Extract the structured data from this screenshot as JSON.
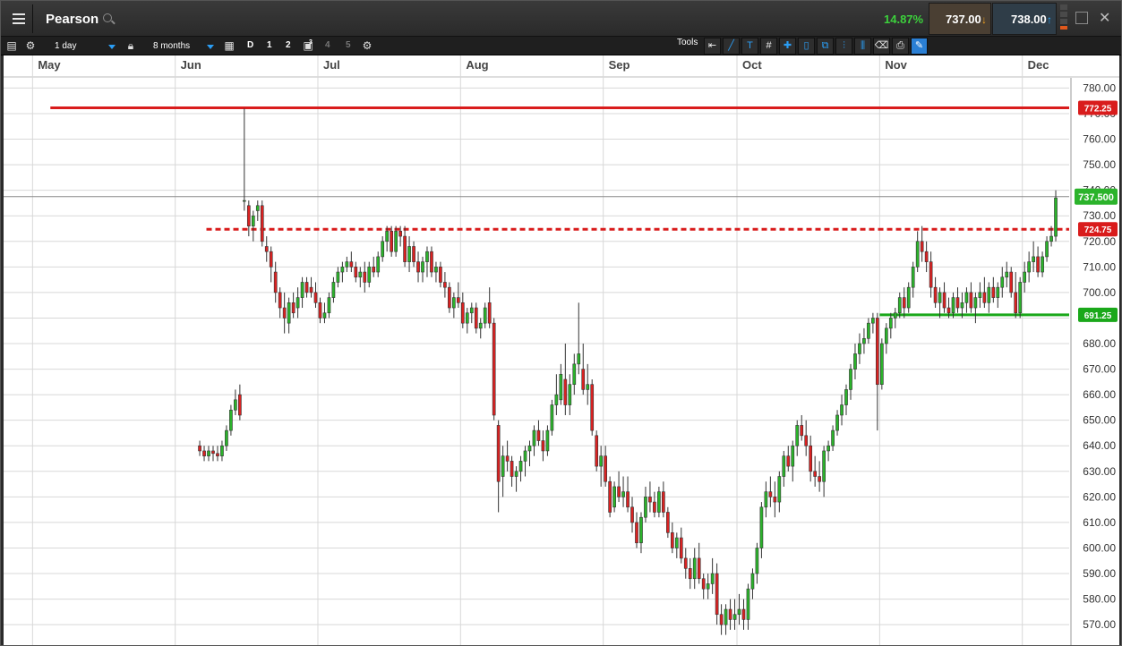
{
  "header": {
    "title": "Pearson",
    "change_pct": "14.87%",
    "sell_price": "737.00",
    "buy_price": "738.00"
  },
  "toolbar": {
    "interval": "1 day",
    "range": "8 months",
    "periods": [
      "D",
      "1",
      "2",
      "3",
      "4",
      "5"
    ],
    "tools_label": "Tools"
  },
  "colors": {
    "up": "#2bb32b",
    "down": "#d92222",
    "resistance": "#d91c1c",
    "support": "#1aa81a",
    "grid": "#d8d8d8",
    "accent": "#2a9df4"
  },
  "chart_data": {
    "type": "candlestick",
    "ylim": [
      562,
      784
    ],
    "yticks": [
      570,
      580,
      590,
      600,
      610,
      620,
      630,
      640,
      650,
      660,
      670,
      680,
      690,
      700,
      710,
      720,
      730,
      740,
      750,
      760,
      770,
      780
    ],
    "ytick_labels": [
      "570.00",
      "580.00",
      "590.00",
      "600.00",
      "610.00",
      "620.00",
      "630.00",
      "640.00",
      "650.00",
      "660.00",
      "670.00",
      "680.00",
      "690.00",
      "700.00",
      "710.00",
      "720.00",
      "730.00",
      "740.00",
      "750.00",
      "760.00",
      "770.00",
      "780.00"
    ],
    "months": [
      "May",
      "Jun",
      "Jul",
      "Aug",
      "Sep",
      "Oct",
      "Nov",
      "Dec"
    ],
    "month_start_index": [
      8,
      40,
      72,
      104,
      136,
      166,
      198,
      230
    ],
    "n_days": 238,
    "levels": [
      {
        "label": "772.25",
        "value": 772.25,
        "style": "solid",
        "color": "resistance",
        "from_index": 12
      },
      {
        "label": "724.75",
        "value": 724.75,
        "style": "dashed",
        "color": "resistance",
        "from_index": 47
      },
      {
        "label": "691.25",
        "value": 691.25,
        "style": "solid",
        "color": "support",
        "from_index": 198
      }
    ],
    "last_price": {
      "label": "737.500",
      "value": 737.5
    },
    "ohlc": [
      [
        640,
        642,
        636,
        638
      ],
      [
        638,
        640,
        634,
        636
      ],
      [
        636,
        640,
        634,
        638
      ],
      [
        638,
        640,
        634,
        637
      ],
      [
        637,
        640,
        634,
        636
      ],
      [
        636,
        642,
        634,
        640
      ],
      [
        640,
        648,
        638,
        646
      ],
      [
        646,
        656,
        644,
        654
      ],
      [
        654,
        662,
        652,
        658
      ],
      [
        660,
        664,
        650,
        652
      ],
      [
        736,
        772,
        732,
        736
      ],
      [
        734,
        736,
        722,
        726
      ],
      [
        726,
        732,
        720,
        730
      ],
      [
        732,
        736,
        728,
        734
      ],
      [
        734,
        736,
        718,
        720
      ],
      [
        718,
        722,
        712,
        716
      ],
      [
        716,
        718,
        704,
        710
      ],
      [
        708,
        712,
        696,
        700
      ],
      [
        700,
        702,
        690,
        694
      ],
      [
        694,
        700,
        684,
        690
      ],
      [
        688,
        698,
        684,
        696
      ],
      [
        696,
        700,
        690,
        692
      ],
      [
        694,
        702,
        690,
        698
      ],
      [
        698,
        706,
        694,
        704
      ],
      [
        704,
        706,
        698,
        700
      ],
      [
        702,
        706,
        698,
        700
      ],
      [
        700,
        704,
        694,
        696
      ],
      [
        696,
        698,
        688,
        690
      ],
      [
        690,
        696,
        688,
        692
      ],
      [
        692,
        700,
        690,
        698
      ],
      [
        698,
        706,
        696,
        704
      ],
      [
        704,
        710,
        702,
        708
      ],
      [
        708,
        712,
        704,
        710
      ],
      [
        710,
        714,
        708,
        712
      ],
      [
        712,
        716,
        708,
        710
      ],
      [
        710,
        712,
        704,
        706
      ],
      [
        706,
        710,
        702,
        708
      ],
      [
        708,
        712,
        700,
        704
      ],
      [
        704,
        712,
        702,
        710
      ],
      [
        710,
        714,
        706,
        708
      ],
      [
        708,
        716,
        706,
        714
      ],
      [
        714,
        722,
        712,
        720
      ],
      [
        720,
        726,
        716,
        724
      ],
      [
        724,
        726,
        714,
        716
      ],
      [
        716,
        726,
        714,
        724
      ],
      [
        724,
        726,
        718,
        722
      ],
      [
        722,
        726,
        710,
        712
      ],
      [
        712,
        722,
        708,
        718
      ],
      [
        718,
        720,
        710,
        712
      ],
      [
        712,
        716,
        704,
        708
      ],
      [
        708,
        714,
        704,
        712
      ],
      [
        712,
        718,
        706,
        716
      ],
      [
        716,
        718,
        706,
        708
      ],
      [
        708,
        712,
        704,
        710
      ],
      [
        710,
        712,
        702,
        704
      ],
      [
        704,
        708,
        698,
        702
      ],
      [
        702,
        704,
        692,
        694
      ],
      [
        694,
        700,
        690,
        698
      ],
      [
        698,
        704,
        694,
        696
      ],
      [
        696,
        700,
        686,
        688
      ],
      [
        688,
        694,
        684,
        692
      ],
      [
        692,
        696,
        688,
        694
      ],
      [
        694,
        696,
        684,
        686
      ],
      [
        686,
        690,
        682,
        688
      ],
      [
        688,
        696,
        686,
        694
      ],
      [
        696,
        702,
        686,
        688
      ],
      [
        688,
        690,
        650,
        652
      ],
      [
        648,
        650,
        614,
        626
      ],
      [
        628,
        640,
        620,
        636
      ],
      [
        636,
        642,
        630,
        634
      ],
      [
        634,
        636,
        624,
        628
      ],
      [
        628,
        632,
        622,
        630
      ],
      [
        630,
        636,
        626,
        634
      ],
      [
        634,
        640,
        628,
        638
      ],
      [
        638,
        642,
        632,
        640
      ],
      [
        640,
        648,
        636,
        646
      ],
      [
        646,
        650,
        640,
        642
      ],
      [
        642,
        646,
        634,
        638
      ],
      [
        638,
        648,
        636,
        646
      ],
      [
        646,
        658,
        644,
        656
      ],
      [
        656,
        668,
        652,
        660
      ],
      [
        658,
        672,
        656,
        668
      ],
      [
        666,
        680,
        652,
        656
      ],
      [
        656,
        668,
        652,
        664
      ],
      [
        664,
        676,
        660,
        672
      ],
      [
        672,
        696,
        668,
        676
      ],
      [
        670,
        680,
        660,
        662
      ],
      [
        662,
        672,
        656,
        664
      ],
      [
        664,
        666,
        644,
        646
      ],
      [
        644,
        646,
        630,
        632
      ],
      [
        632,
        640,
        624,
        636
      ],
      [
        636,
        640,
        624,
        626
      ],
      [
        626,
        628,
        612,
        614
      ],
      [
        616,
        626,
        614,
        624
      ],
      [
        624,
        630,
        618,
        620
      ],
      [
        620,
        628,
        616,
        622
      ],
      [
        622,
        628,
        614,
        616
      ],
      [
        616,
        620,
        606,
        610
      ],
      [
        610,
        614,
        600,
        602
      ],
      [
        602,
        614,
        598,
        612
      ],
      [
        612,
        624,
        610,
        620
      ],
      [
        620,
        626,
        614,
        618
      ],
      [
        618,
        622,
        612,
        614
      ],
      [
        614,
        624,
        612,
        622
      ],
      [
        622,
        626,
        612,
        614
      ],
      [
        614,
        616,
        604,
        606
      ],
      [
        606,
        610,
        598,
        600
      ],
      [
        600,
        606,
        596,
        604
      ],
      [
        604,
        608,
        594,
        596
      ],
      [
        596,
        600,
        588,
        592
      ],
      [
        592,
        596,
        584,
        588
      ],
      [
        588,
        600,
        584,
        596
      ],
      [
        596,
        602,
        586,
        588
      ],
      [
        588,
        590,
        580,
        584
      ],
      [
        584,
        590,
        580,
        586
      ],
      [
        586,
        596,
        582,
        590
      ],
      [
        590,
        594,
        570,
        574
      ],
      [
        574,
        578,
        566,
        570
      ],
      [
        570,
        578,
        566,
        576
      ],
      [
        576,
        580,
        568,
        572
      ],
      [
        572,
        580,
        568,
        574
      ],
      [
        574,
        582,
        570,
        576
      ],
      [
        576,
        580,
        568,
        572
      ],
      [
        572,
        586,
        568,
        584
      ],
      [
        584,
        592,
        580,
        590
      ],
      [
        590,
        602,
        586,
        600
      ],
      [
        600,
        618,
        596,
        616
      ],
      [
        616,
        626,
        612,
        622
      ],
      [
        622,
        628,
        616,
        620
      ],
      [
        620,
        626,
        612,
        618
      ],
      [
        618,
        630,
        614,
        628
      ],
      [
        628,
        638,
        624,
        636
      ],
      [
        636,
        640,
        630,
        632
      ],
      [
        632,
        642,
        626,
        640
      ],
      [
        640,
        650,
        636,
        648
      ],
      [
        648,
        652,
        642,
        644
      ],
      [
        644,
        650,
        636,
        640
      ],
      [
        640,
        644,
        626,
        630
      ],
      [
        630,
        636,
        624,
        628
      ],
      [
        628,
        634,
        622,
        626
      ],
      [
        626,
        640,
        620,
        638
      ],
      [
        638,
        642,
        634,
        640
      ],
      [
        640,
        648,
        638,
        646
      ],
      [
        646,
        654,
        644,
        652
      ],
      [
        652,
        660,
        648,
        656
      ],
      [
        656,
        664,
        652,
        662
      ],
      [
        662,
        672,
        658,
        670
      ],
      [
        670,
        680,
        666,
        676
      ],
      [
        676,
        684,
        672,
        680
      ],
      [
        680,
        686,
        676,
        682
      ],
      [
        682,
        690,
        680,
        688
      ],
      [
        688,
        692,
        684,
        690
      ],
      [
        690,
        692,
        646,
        664
      ],
      [
        664,
        682,
        662,
        680
      ],
      [
        680,
        688,
        676,
        686
      ],
      [
        686,
        692,
        682,
        690
      ],
      [
        690,
        694,
        686,
        692
      ],
      [
        692,
        700,
        690,
        698
      ],
      [
        698,
        702,
        690,
        694
      ],
      [
        694,
        704,
        692,
        702
      ],
      [
        702,
        712,
        698,
        710
      ],
      [
        710,
        724,
        708,
        720
      ],
      [
        720,
        726,
        712,
        716
      ],
      [
        716,
        720,
        708,
        712
      ],
      [
        712,
        716,
        698,
        702
      ],
      [
        702,
        706,
        694,
        696
      ],
      [
        696,
        702,
        690,
        700
      ],
      [
        700,
        704,
        692,
        694
      ],
      [
        694,
        698,
        690,
        692
      ],
      [
        692,
        700,
        690,
        698
      ],
      [
        698,
        702,
        692,
        694
      ],
      [
        694,
        700,
        690,
        696
      ],
      [
        696,
        702,
        692,
        700
      ],
      [
        700,
        704,
        692,
        694
      ],
      [
        694,
        700,
        688,
        698
      ],
      [
        698,
        704,
        694,
        700
      ],
      [
        700,
        706,
        694,
        696
      ],
      [
        696,
        704,
        692,
        702
      ],
      [
        702,
        706,
        696,
        698
      ],
      [
        698,
        704,
        694,
        702
      ],
      [
        702,
        710,
        698,
        706
      ],
      [
        706,
        712,
        702,
        708
      ],
      [
        708,
        710,
        698,
        700
      ],
      [
        700,
        708,
        690,
        692
      ],
      [
        692,
        706,
        690,
        704
      ],
      [
        704,
        712,
        700,
        708
      ],
      [
        708,
        716,
        704,
        712
      ],
      [
        712,
        720,
        708,
        714
      ],
      [
        714,
        718,
        706,
        708
      ],
      [
        708,
        716,
        706,
        714
      ],
      [
        714,
        722,
        712,
        720
      ],
      [
        720,
        726,
        718,
        722
      ],
      [
        722,
        740,
        720,
        737
      ]
    ]
  }
}
